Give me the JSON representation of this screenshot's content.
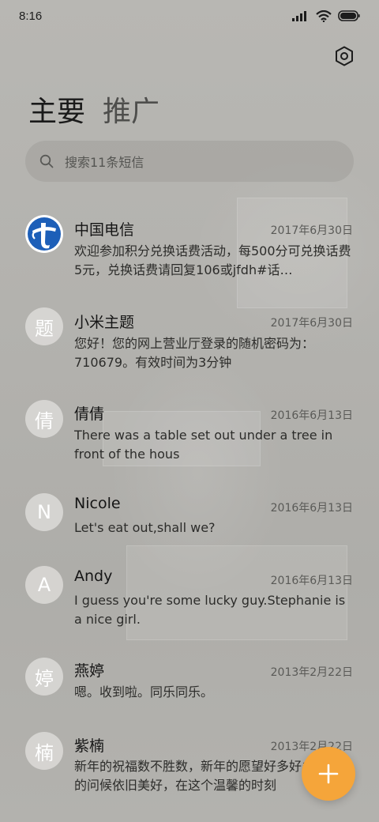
{
  "status_bar": {
    "time": "8:16"
  },
  "tabs": [
    {
      "label": "主要",
      "active": true
    },
    {
      "label": "推广",
      "active": false
    }
  ],
  "search": {
    "placeholder": "搜索11条短信"
  },
  "conversations": [
    {
      "name": "中国电信",
      "date": "2017年6月30日",
      "avatar_icon": "china-telecom-logo",
      "preview": "欢迎参加积分兑换话费活动，每500分可兑换话费5元，兑换话费请回复106或jfdh#话…"
    },
    {
      "name": "小米主题",
      "date": "2017年6月30日",
      "avatar_text": "题",
      "preview": "您好！您的网上营业厅登录的随机密码为：710679。有效时间为3分钟"
    },
    {
      "name": "倩倩",
      "date": "2016年6月13日",
      "avatar_text": "倩",
      "preview": "There was a table set out under a tree in front of the hous"
    },
    {
      "name": "Nicole",
      "date": "2016年6月13日",
      "avatar_text": "N",
      "preview": "Let's eat out,shall we?"
    },
    {
      "name": "Andy",
      "date": "2016年6月13日",
      "avatar_text": "A",
      "preview": "I guess you're some lucky guy.Stephanie is a nice girl."
    },
    {
      "name": "燕婷",
      "date": "2013年2月22日",
      "avatar_text": "婷",
      "preview": "嗯。收到啦。同乐同乐。"
    },
    {
      "name": "紫楠",
      "date": "2013年2月22日",
      "avatar_text": "楠",
      "preview": "新年的祝福数不胜数，新年的愿望好多好多，新年的问候依旧美好，在这个温馨的时刻"
    }
  ],
  "colors": {
    "fab": "#f5a53a",
    "background": "#b6b5b1"
  },
  "icons": {
    "settings": "settings-hexagon-icon",
    "search": "search-icon",
    "compose": "plus-icon"
  }
}
